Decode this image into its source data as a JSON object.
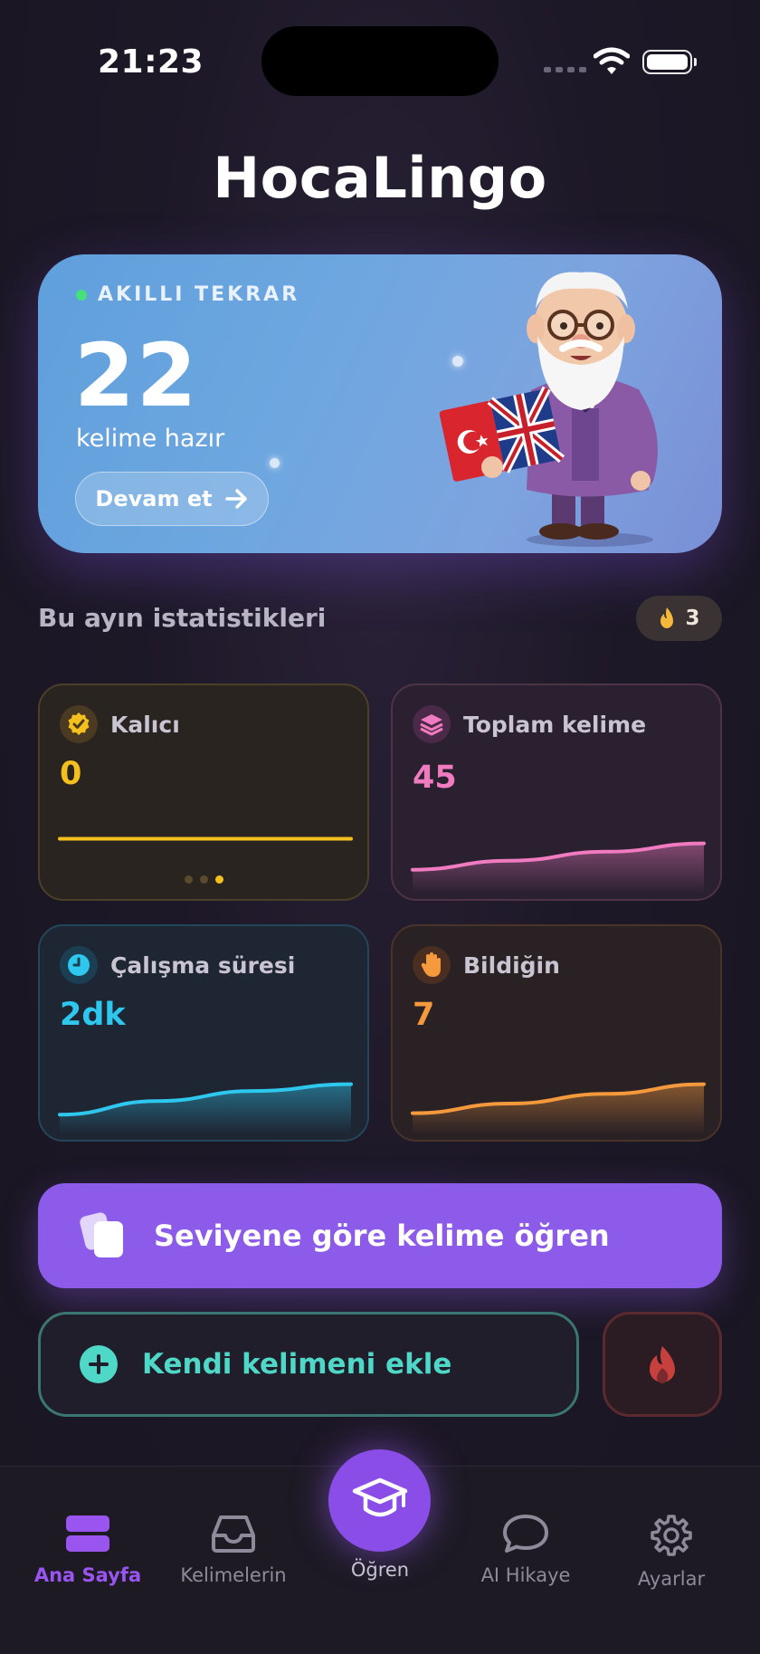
{
  "status_bar": {
    "time": "21:23"
  },
  "app": {
    "title": "HocaLingo"
  },
  "hero": {
    "tag": "AKILLI TEKRAR",
    "count": "22",
    "subtitle": "kelime hazır",
    "button_label": "Devam et"
  },
  "stats": {
    "section_title": "Bu ayın istatistikleri",
    "streak": "3",
    "cards": [
      {
        "label": "Kalıcı",
        "value": "0",
        "color": "#f4c01e",
        "trend": [
          0,
          0,
          0,
          0
        ],
        "pager": {
          "total": 3,
          "active": 3
        }
      },
      {
        "label": "Toplam kelime",
        "value": "45",
        "color": "#f07bc0",
        "trend": [
          10,
          22,
          34,
          45
        ]
      },
      {
        "label": "Çalışma süresi",
        "value": "2dk",
        "color": "#2ec8ef",
        "trend": [
          0.2,
          1.0,
          1.6,
          2.0
        ]
      },
      {
        "label": "Bildiğin",
        "value": "7",
        "color": "#f59a3c",
        "trend": [
          1,
          3,
          5,
          7
        ]
      }
    ]
  },
  "actions": {
    "learn_label": "Seviyene göre kelime öğren",
    "add_label": "Kendi kelimeni ekle"
  },
  "tabbar": {
    "items": [
      {
        "label": "Ana Sayfa",
        "icon": "home-icon",
        "active": true
      },
      {
        "label": "Kelimelerin",
        "icon": "inbox-icon"
      },
      {
        "label": "Öğren",
        "icon": "graduation-cap-icon"
      },
      {
        "label": "AI Hikaye",
        "icon": "chat-bubble-icon"
      },
      {
        "label": "Ayarlar",
        "icon": "gear-icon"
      }
    ]
  },
  "colors": {
    "accent": "#8c5bea",
    "teal": "#4fd8c8",
    "hero_start": "#5f9fdc",
    "hero_end": "#7a8fd6",
    "active_tab": "#9a55f0"
  }
}
